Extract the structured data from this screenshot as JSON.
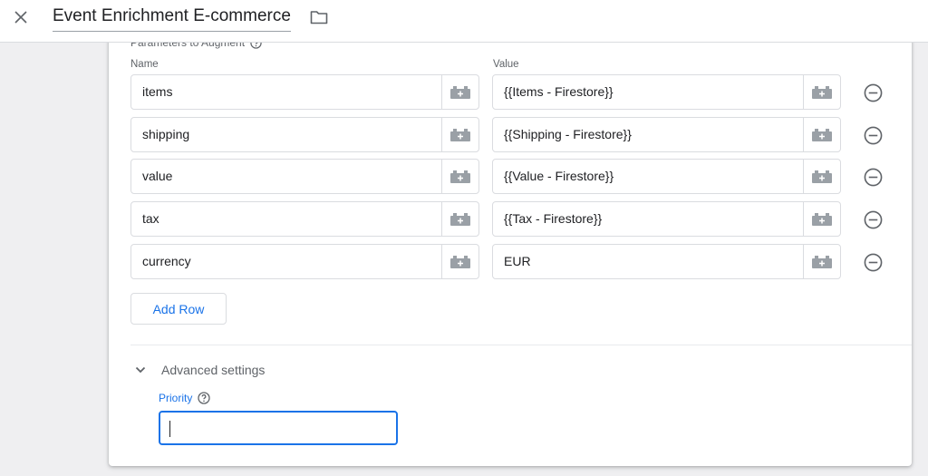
{
  "header": {
    "title": "Event Enrichment E-commerce"
  },
  "params": {
    "section_label": "Parameters to Augment",
    "name_col": "Name",
    "value_col": "Value",
    "rows": [
      {
        "name": "items",
        "value": "{{Items - Firestore}}"
      },
      {
        "name": "shipping",
        "value": "{{Shipping - Firestore}}"
      },
      {
        "name": "value",
        "value": "{{Value - Firestore}}"
      },
      {
        "name": "tax",
        "value": "{{Tax - Firestore}}"
      },
      {
        "name": "currency",
        "value": "EUR"
      }
    ],
    "add_row_label": "Add Row"
  },
  "advanced": {
    "label": "Advanced settings",
    "priority_label": "Priority",
    "priority_value": ""
  },
  "colors": {
    "accent": "#1a73e8",
    "icon_grey": "#9aa0a6",
    "text": "#202124",
    "muted": "#5f6368"
  }
}
